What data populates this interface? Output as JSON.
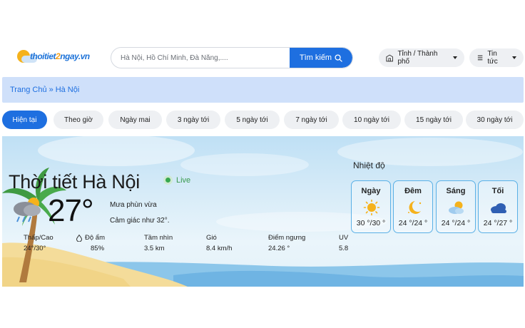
{
  "header": {
    "logo_text_blue": "thoitiet",
    "logo_text_orange": "2",
    "logo_text_tail": "ngay.vn",
    "search_placeholder": "Hà Nội, Hồ Chí Minh, Đà Nẵng,....",
    "search_button": "Tìm kiếm",
    "province_menu": "Tỉnh / Thành phố",
    "news_menu": "Tin tức"
  },
  "breadcrumb": {
    "home": "Trang Chủ",
    "separator": "»",
    "current": "Hà Nội"
  },
  "tabs": [
    {
      "label": "Hiện tại",
      "active": true
    },
    {
      "label": "Theo giờ",
      "active": false
    },
    {
      "label": "Ngày mai",
      "active": false
    },
    {
      "label": "3 ngày tới",
      "active": false
    },
    {
      "label": "5 ngày tới",
      "active": false
    },
    {
      "label": "7 ngày tới",
      "active": false
    },
    {
      "label": "10 ngày tới",
      "active": false
    },
    {
      "label": "15 ngày tới",
      "active": false
    },
    {
      "label": "30 ngày tới",
      "active": false
    }
  ],
  "current": {
    "title": "Thời tiết Hà Nội",
    "live": "Live",
    "temperature": "27°",
    "description": "Mưa phùn vừa",
    "feels_like": "Cảm giác như 32°.",
    "icon": "cloud-sun-rain-icon"
  },
  "stats": [
    {
      "label": "Thấp/Cao",
      "value": "24°/30°",
      "icon": "thermometer-icon"
    },
    {
      "label": "Độ ẩm",
      "value": "85%",
      "icon": "droplet-icon"
    },
    {
      "label": "Tầm nhìn",
      "value": "3.5 km",
      "icon": "eye-icon"
    },
    {
      "label": "Gió",
      "value": "8.4 km/h",
      "icon": "wind-icon"
    },
    {
      "label": "Điểm ngưng",
      "value": "24.26 °",
      "icon": "dew-icon"
    },
    {
      "label": "UV",
      "value": "5.8",
      "icon": "sun-icon"
    }
  ],
  "temperature_panel": {
    "label": "Nhiệt độ",
    "cards": [
      {
        "name": "Ngày",
        "range": "30 °/30 °",
        "icon": "sun-icon"
      },
      {
        "name": "Đêm",
        "range": "24 °/24 °",
        "icon": "moon-stars-icon"
      },
      {
        "name": "Sáng",
        "range": "24 °/24 °",
        "icon": "sun-cloud-icon"
      },
      {
        "name": "Tối",
        "range": "24 °/27 °",
        "icon": "cloud-icon"
      }
    ]
  },
  "colors": {
    "accent": "#1e6fe0",
    "breadcrumb_bg": "#cfe0fa",
    "live_green": "#37a84e",
    "card_border": "#5ab0e6"
  }
}
